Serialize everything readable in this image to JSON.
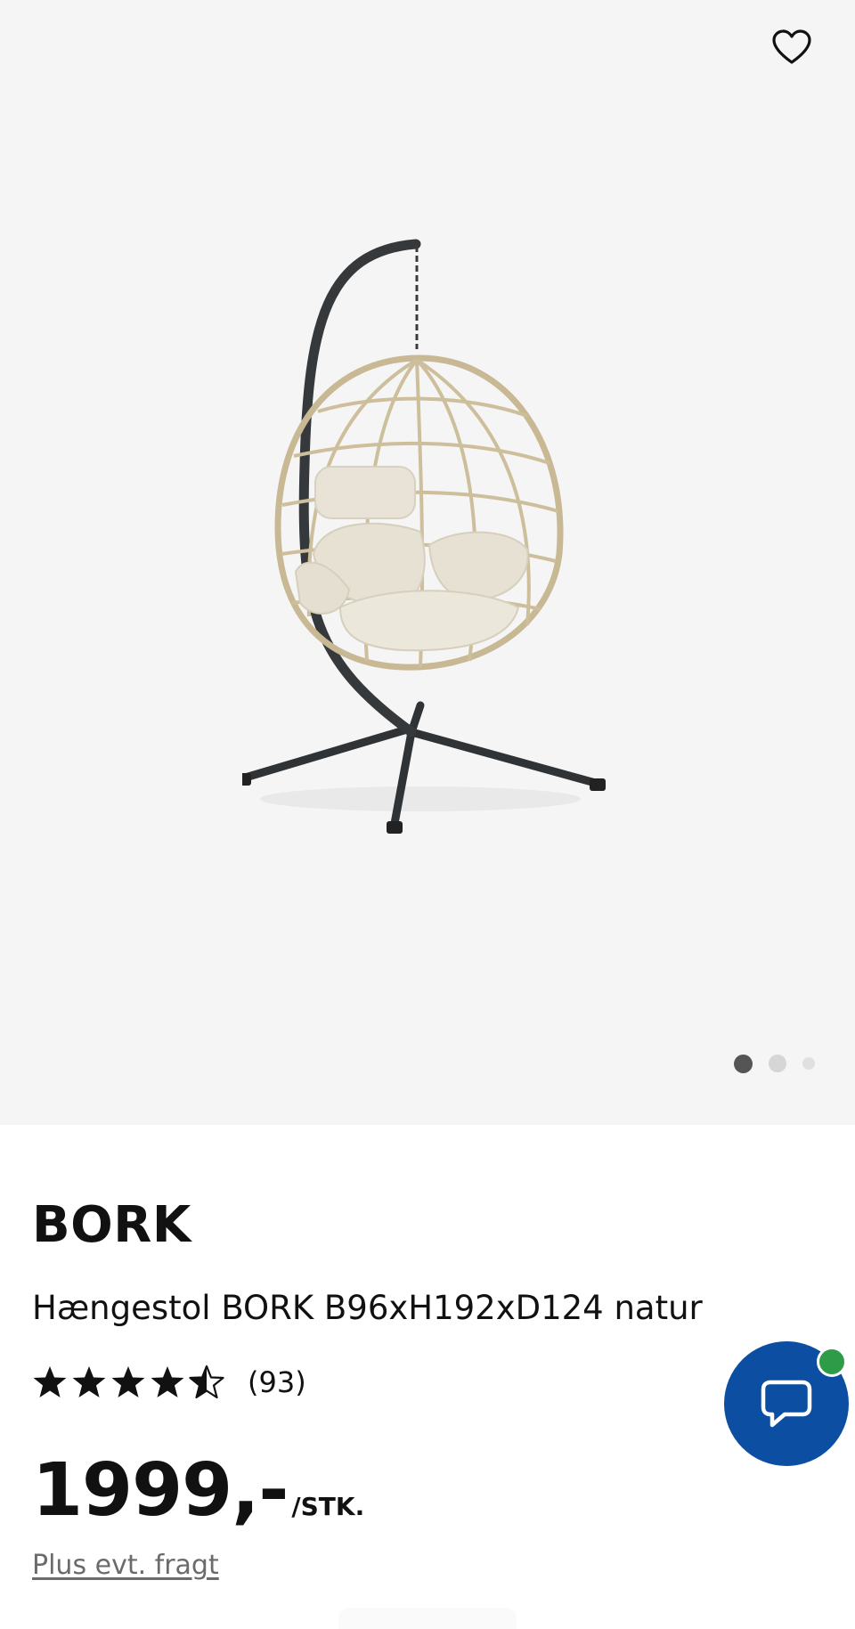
{
  "gallery": {
    "image_alt": "Hængestol BORK natur",
    "favorite_icon": "heart-outline-icon",
    "dots_count": 3,
    "active_dot": 1
  },
  "product": {
    "brand": "BORK",
    "name": "Hængestol BORK B96xH192xD124 natur",
    "rating": 4.5,
    "rating_max": 5,
    "review_count": "(93)",
    "price": "1999,-",
    "unit": "/STK.",
    "freight_link": "Plus evt. fragt"
  },
  "chat": {
    "icon": "chat-bubble-icon",
    "status": "online",
    "status_color": "#2e9b49",
    "button_color": "#0b4ea2"
  }
}
